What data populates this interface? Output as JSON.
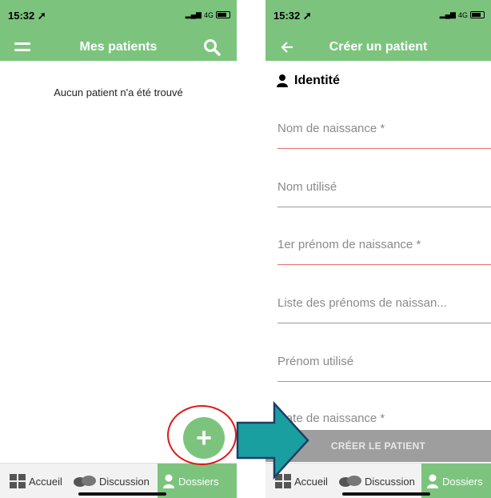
{
  "left_screen": {
    "status": {
      "time": "15:32",
      "network": "4G"
    },
    "appbar": {
      "title": "Mes patients"
    },
    "empty_message": "Aucun patient n'a été trouvé",
    "fab_label": "+",
    "nav": {
      "home": "Accueil",
      "discussions": "Discussion",
      "files": "Dossiers"
    }
  },
  "right_screen": {
    "status": {
      "time": "15:32",
      "network": "4G"
    },
    "appbar": {
      "title": "Créer un patient"
    },
    "section_title": "Identité",
    "fields": [
      {
        "placeholder": "Nom de naissance *"
      },
      {
        "placeholder": "Nom utilisé"
      },
      {
        "placeholder": "1er prénom de naissance *"
      },
      {
        "placeholder": "Liste des prénoms de naissan..."
      },
      {
        "placeholder": "Prénom utilisé"
      },
      {
        "placeholder": "Date de naissance *"
      }
    ],
    "submit_label": "CRÉER LE PATIENT",
    "nav": {
      "home": "Accueil",
      "discussions": "Discussion",
      "files": "Dossiers"
    }
  },
  "colors": {
    "primary": "#7cc47e",
    "highlight_ring": "#e01818",
    "arrow": "#1a9fa0",
    "required_line": "#e57373"
  }
}
